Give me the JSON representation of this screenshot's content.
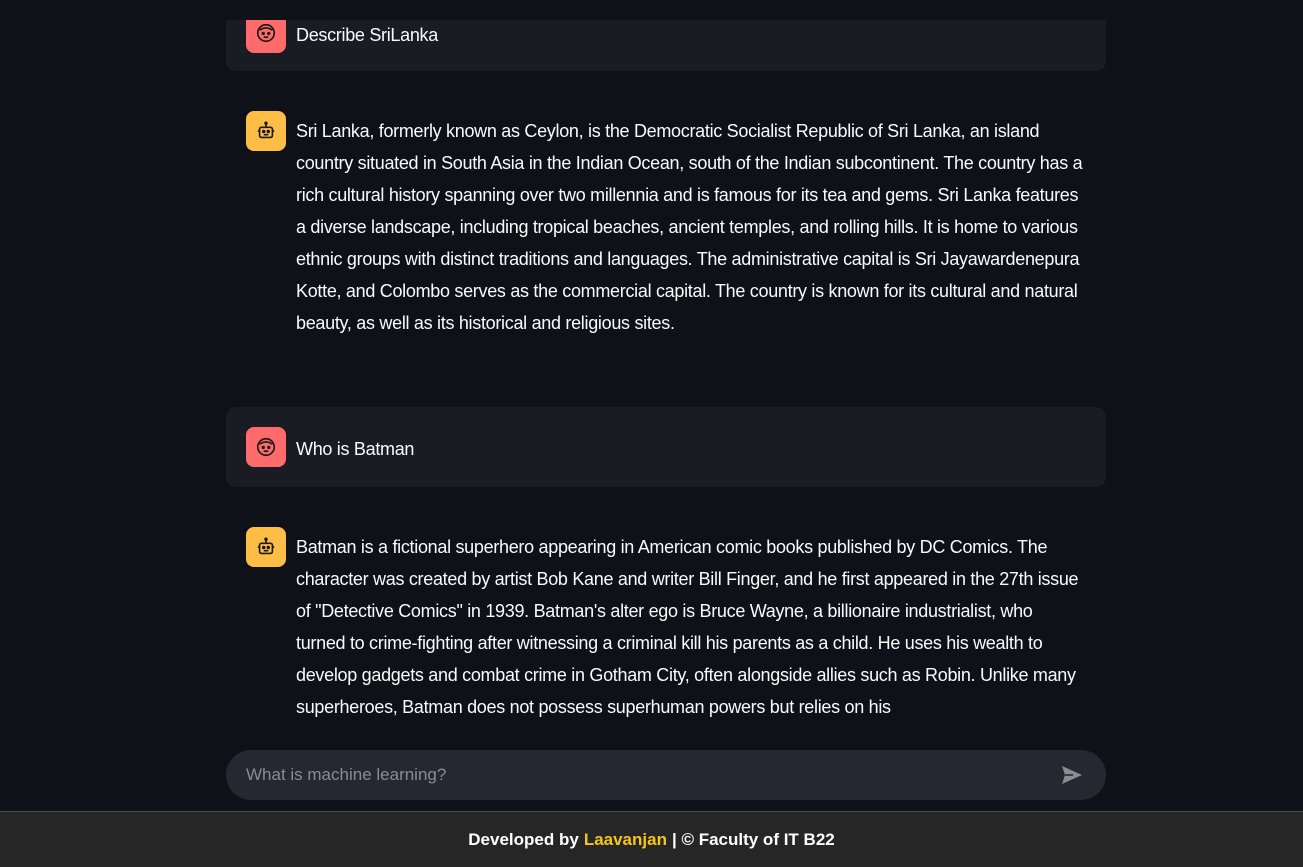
{
  "messages": [
    {
      "role": "user",
      "text": "Describe SriLanka"
    },
    {
      "role": "assistant",
      "text": "Sri Lanka, formerly known as Ceylon, is the Democratic Socialist Republic of Sri Lanka, an island country situated in South Asia in the Indian Ocean, south of the Indian subcontinent. The country has a rich cultural history spanning over two millennia and is famous for its tea and gems. Sri Lanka features a diverse landscape, including tropical beaches, ancient temples, and rolling hills. It is home to various ethnic groups with distinct traditions and languages. The administrative capital is Sri Jayawardenepura Kotte, and Colombo serves as the commercial capital. The country is known for its cultural and natural beauty, as well as its historical and religious sites."
    },
    {
      "role": "user",
      "text": "Who is Batman"
    },
    {
      "role": "assistant",
      "text": "Batman is a fictional superhero appearing in American comic books published by DC Comics. The character was created by artist Bob Kane and writer Bill Finger, and he first appeared in the 27th issue of \"Detective Comics\" in 1939. Batman's alter ego is Bruce Wayne, a billionaire industrialist, who turned to crime-fighting after witnessing a criminal kill his parents as a child. He uses his wealth to develop gadgets and combat crime in Gotham City, often alongside allies such as Robin. Unlike many superheroes, Batman does not possess superhuman powers but relies on his"
    }
  ],
  "chat_input": {
    "placeholder": "What is machine learning?",
    "value": ""
  },
  "footer": {
    "prefix": "Developed by",
    "developer": "Laavanjan",
    "suffix": "| © Faculty of IT B22"
  },
  "colors": {
    "background": "#0e1117",
    "user_bubble": "#1a1c24",
    "user_avatar": "#ff6b6b",
    "bot_avatar": "#ffbd45",
    "developer_name": "#f5c518"
  },
  "icons": {
    "user_avatar": "user-face-icon",
    "bot_avatar": "robot-icon",
    "send": "send-icon"
  }
}
